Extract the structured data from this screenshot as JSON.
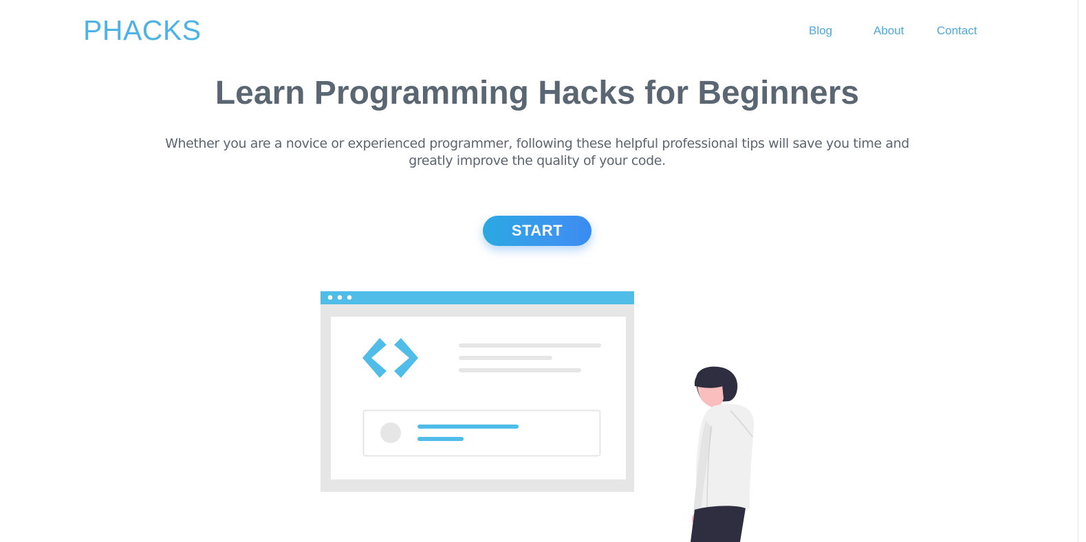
{
  "header": {
    "logo": "PHACKS",
    "nav": [
      {
        "label": "Blog"
      },
      {
        "label": "About"
      },
      {
        "label": "Contact"
      }
    ]
  },
  "hero": {
    "title": "Learn Programming Hacks for Beginners",
    "subtitle": "Whether you are a novice or experienced programmer, following these helpful professional tips will save you time and greatly improve the quality of your code.",
    "cta_label": "START"
  },
  "illustration": {
    "icons": [
      "browser-window-icon",
      "code-brackets-icon",
      "person-figure-icon"
    ],
    "colors": {
      "accent": "#4fbde8",
      "window_frame": "#e6e6e6",
      "text_lines": "#e6e6e6",
      "hair": "#2f2e41",
      "skin": "#fbbebe",
      "hoodie": "#f0f0f0",
      "pants": "#2f2e41"
    }
  }
}
